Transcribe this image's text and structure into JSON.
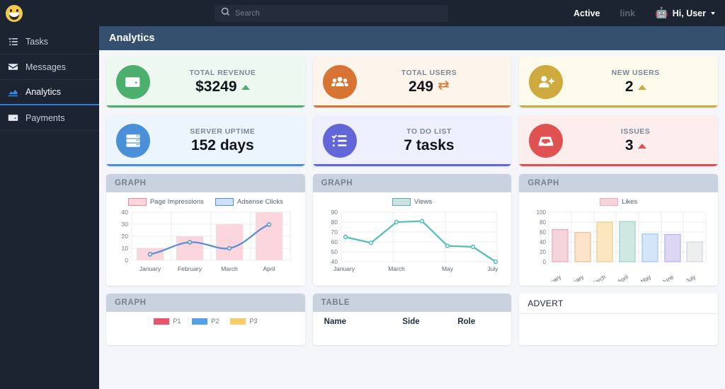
{
  "topbar": {
    "logo_icon": "smiley-face-icon",
    "search": {
      "value": "",
      "placeholder": "Search",
      "icon": "search-icon"
    },
    "active_label": "Active",
    "link_label": "link",
    "user": {
      "avatar_icon": "robot-emoji",
      "label": "Hi, User",
      "caret_icon": "chevron-down-icon"
    }
  },
  "sidebar": {
    "items": [
      {
        "label": "Tasks",
        "icon": "task-list-icon",
        "active": false
      },
      {
        "label": "Messages",
        "icon": "envelope-icon",
        "active": false
      },
      {
        "label": "Analytics",
        "icon": "bar-chart-icon",
        "active": true
      },
      {
        "label": "Payments",
        "icon": "wallet-icon",
        "active": false
      }
    ]
  },
  "page": {
    "title": "Analytics"
  },
  "stats": [
    {
      "label": "TOTAL REVENUE",
      "value": "$3249",
      "icon": "wallet-icon",
      "trend": "up",
      "accent": "#4caf6e",
      "bg": "#edf8f0"
    },
    {
      "label": "TOTAL USERS",
      "value": "249",
      "icon": "users-group-icon",
      "trend": "swap",
      "accent": "#d77433",
      "bg": "#fdf4ec"
    },
    {
      "label": "NEW USERS",
      "value": "2",
      "icon": "user-plus-icon",
      "trend": "up",
      "accent": "#ceaa3e",
      "bg": "#fcfaea"
    },
    {
      "label": "SERVER UPTIME",
      "value": "152 days",
      "icon": "server-icon",
      "trend": "none",
      "accent": "#4a90d9",
      "bg": "#ecf5fd"
    },
    {
      "label": "TO DO LIST",
      "value": "7 tasks",
      "icon": "checklist-icon",
      "trend": "none",
      "accent": "#6366d8",
      "bg": "#eef0fd"
    },
    {
      "label": "ISSUES",
      "value": "3",
      "icon": "inbox-icon",
      "trend": "up",
      "accent": "#e05252",
      "bg": "#fdeeee"
    }
  ],
  "panels": {
    "graph1_title": "GRAPH",
    "graph2_title": "GRAPH",
    "graph3_title": "GRAPH",
    "graph4_title": "GRAPH",
    "table_title": "TABLE",
    "advert_title": "ADVERT"
  },
  "table": {
    "columns": [
      "Name",
      "Side",
      "Role"
    ]
  },
  "chart_data": [
    {
      "id": "graph1",
      "type": "bar",
      "title": "",
      "categories": [
        "January",
        "February",
        "March",
        "April"
      ],
      "series": [
        {
          "name": "Page Impressions",
          "type": "bar",
          "values": [
            10,
            20,
            30,
            40
          ],
          "color": "#fbd6dd",
          "border": "#f2899f"
        },
        {
          "name": "Adsense Clicks",
          "type": "line",
          "values": [
            5,
            15,
            10,
            30
          ],
          "color": "#5b8fd4",
          "border": "#5b8fd4"
        }
      ],
      "ylim": [
        0,
        40
      ],
      "yticks": [
        0,
        10,
        20,
        30,
        40
      ],
      "xlabel": "",
      "ylabel": "",
      "grid": true,
      "legend_position": "top"
    },
    {
      "id": "graph2",
      "type": "line",
      "title": "",
      "categories": [
        "January",
        "",
        "March",
        "",
        "May",
        "",
        "July"
      ],
      "tick_labels": [
        "January",
        "March",
        "May",
        "July"
      ],
      "series": [
        {
          "name": "Views",
          "values": [
            65,
            59,
            80,
            81,
            56,
            55,
            40
          ],
          "color": "#57bfb8"
        }
      ],
      "ylim": [
        40,
        90
      ],
      "yticks": [
        40,
        50,
        60,
        70,
        80,
        90
      ],
      "xlabel": "",
      "ylabel": "",
      "grid": true,
      "legend_position": "top"
    },
    {
      "id": "graph3",
      "type": "bar",
      "title": "",
      "categories": [
        "January",
        "February",
        "March",
        "April",
        "May",
        "June",
        "July"
      ],
      "series": [
        {
          "name": "Likes",
          "values": [
            65,
            59,
            80,
            81,
            56,
            55,
            40
          ],
          "colors": [
            "#f6d4dc",
            "#fbe2c8",
            "#fbe7bf",
            "#cde9e2",
            "#d4e5f7",
            "#ddd7f5",
            "#eceef0"
          ],
          "borders": [
            "#e8aebc",
            "#ecc49a",
            "#ecd092",
            "#9fd3c8",
            "#a8c8ea",
            "#bdb2ea",
            "#d3d7dc"
          ]
        }
      ],
      "ylim": [
        0,
        100
      ],
      "yticks": [
        0,
        20,
        40,
        60,
        80,
        100
      ],
      "xlabel": "",
      "ylabel": "",
      "grid": true,
      "legend_position": "top"
    },
    {
      "id": "graph4",
      "type": "bar",
      "title": "",
      "legend_entries": [
        "P1",
        "P2",
        "P3"
      ],
      "legend_colors": [
        "#e8546a",
        "#54a0e8",
        "#f5cd6a"
      ],
      "legend_position": "top"
    }
  ]
}
